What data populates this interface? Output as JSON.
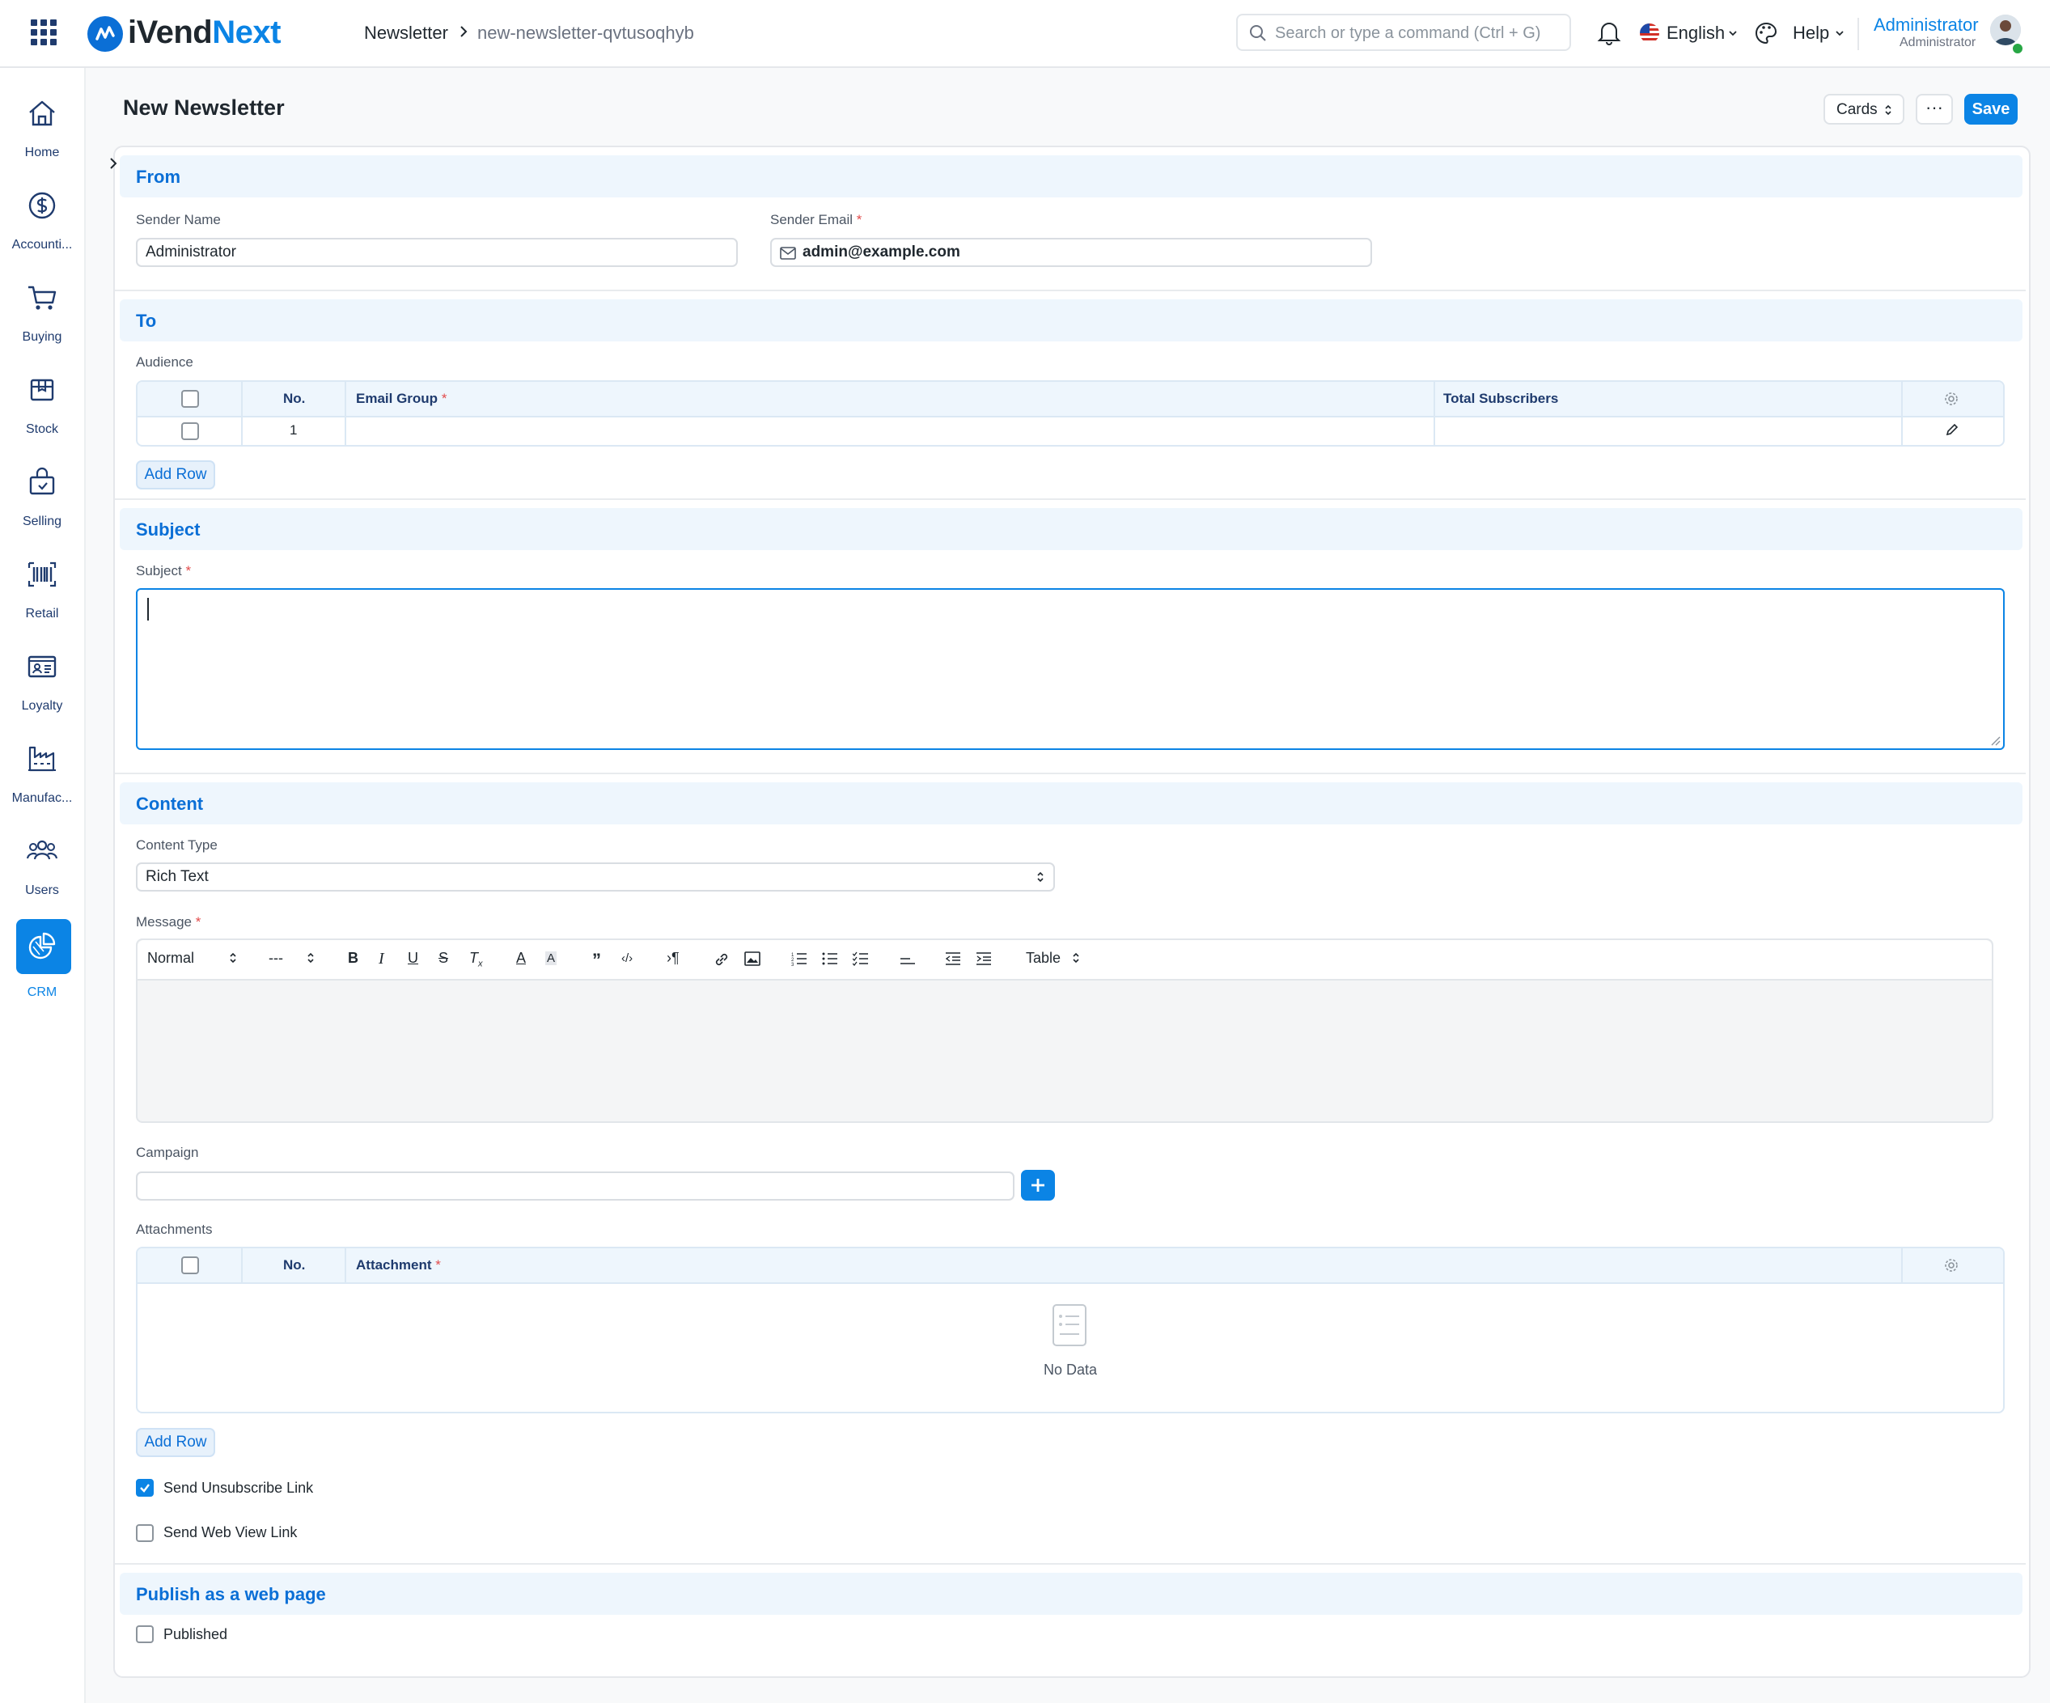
{
  "app": {
    "logo_part1": "iVend",
    "logo_part2": "Next",
    "accent_color": "#0b84e5"
  },
  "breadcrumb": {
    "items": [
      "Newsletter",
      "new-newsletter-qvtusoqhyb"
    ]
  },
  "search": {
    "placeholder": "Search or type a command (Ctrl + G)"
  },
  "topbar": {
    "language": "English",
    "help": "Help",
    "user_name": "Administrator",
    "user_role": "Administrator"
  },
  "sidebar": {
    "items": [
      {
        "label": "Home",
        "icon": "home-icon"
      },
      {
        "label": "Accounti...",
        "icon": "dollar-icon"
      },
      {
        "label": "Buying",
        "icon": "cart-icon"
      },
      {
        "label": "Stock",
        "icon": "box-icon"
      },
      {
        "label": "Selling",
        "icon": "shopping-bag-icon"
      },
      {
        "label": "Retail",
        "icon": "barcode-icon"
      },
      {
        "label": "Loyalty",
        "icon": "id-card-icon"
      },
      {
        "label": "Manufac...",
        "icon": "factory-icon"
      },
      {
        "label": "Users",
        "icon": "users-icon"
      },
      {
        "label": "CRM",
        "icon": "pie-chart-icon",
        "active": true
      }
    ]
  },
  "page": {
    "title": "New Newsletter",
    "view_selector": "Cards",
    "more": "···",
    "save": "Save"
  },
  "form": {
    "from": {
      "title": "From",
      "sender_name_label": "Sender Name",
      "sender_name_value": "Administrator",
      "sender_email_label": "Sender Email",
      "sender_email_value": "admin@example.com"
    },
    "to": {
      "title": "To",
      "audience_label": "Audience",
      "columns": [
        "No.",
        "Email Group",
        "Total Subscribers"
      ],
      "rows": [
        {
          "no": "1",
          "email_group": "",
          "total_subscribers": ""
        }
      ],
      "add_row": "Add Row"
    },
    "subject": {
      "title": "Subject",
      "label": "Subject",
      "value": ""
    },
    "content": {
      "title": "Content",
      "content_type_label": "Content Type",
      "content_type_value": "Rich Text",
      "message_label": "Message",
      "toolbar": {
        "style": "Normal",
        "size": "---",
        "table": "Table"
      },
      "campaign_label": "Campaign",
      "campaign_value": "",
      "attachments_label": "Attachments",
      "attachment_columns": [
        "No.",
        "Attachment"
      ],
      "no_data": "No Data",
      "add_row": "Add Row",
      "send_unsubscribe_label": "Send Unsubscribe Link",
      "send_unsubscribe_checked": true,
      "send_web_view_label": "Send Web View Link",
      "send_web_view_checked": false
    },
    "publish": {
      "title": "Publish as a web page",
      "published_label": "Published",
      "published_checked": false
    }
  }
}
